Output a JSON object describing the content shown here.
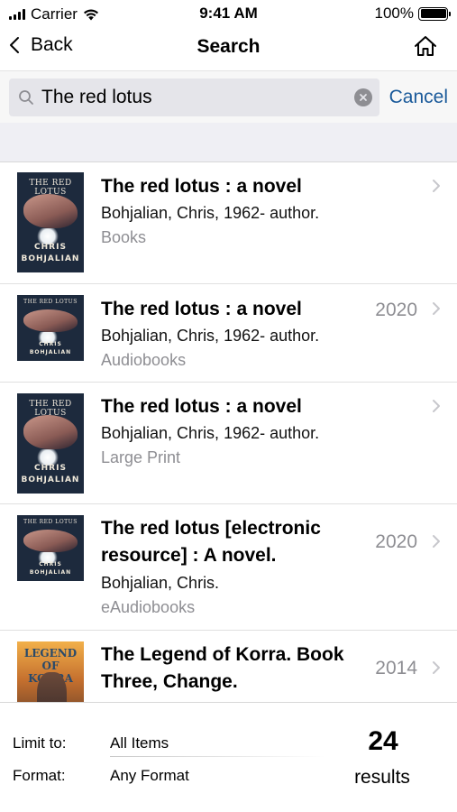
{
  "status_bar": {
    "carrier": "Carrier",
    "time": "9:41 AM",
    "battery": "100%"
  },
  "nav": {
    "back_label": "Back",
    "title": "Search",
    "home_icon": "home-icon"
  },
  "search": {
    "query": "The red lotus",
    "cancel_label": "Cancel"
  },
  "results": [
    {
      "title": "The red lotus : a novel",
      "author": "Bohjalian, Chris, 1962- author.",
      "format": "Books",
      "year": "",
      "cover": {
        "title": "THE RED LOTUS",
        "author_first": "CHRIS",
        "author_last": "BOHJALIAN"
      }
    },
    {
      "title": "The red lotus : a novel",
      "author": "Bohjalian, Chris, 1962- author.",
      "format": "Audiobooks",
      "year": "2020",
      "cover": {
        "title": "THE RED LOTUS",
        "author_first": "CHRIS",
        "author_last": "BOHJALIAN"
      }
    },
    {
      "title": "The red lotus : a novel",
      "author": "Bohjalian, Chris, 1962- author.",
      "format": "Large Print",
      "year": "",
      "cover": {
        "title": "THE RED LOTUS",
        "author_first": "CHRIS",
        "author_last": "BOHJALIAN"
      }
    },
    {
      "title_line1": "The red lotus [electronic",
      "title_line2": "resource] : A novel.",
      "author": "Bohjalian, Chris.",
      "format": "eAudiobooks",
      "year": "2020",
      "cover": {
        "title": "THE RED LOTUS",
        "author_first": "CHRIS",
        "author_last": "BOHJALIAN"
      }
    },
    {
      "title_line1": "The Legend of Korra. Book",
      "title_line2": "Three, Change.",
      "year": "2014",
      "cover": {
        "title": "LEGEND OF KORRA"
      }
    }
  ],
  "footer": {
    "limit_label": "Limit to:",
    "limit_value": "All Items",
    "format_label": "Format:",
    "format_value": "Any Format",
    "count": "24",
    "count_label": "results"
  }
}
